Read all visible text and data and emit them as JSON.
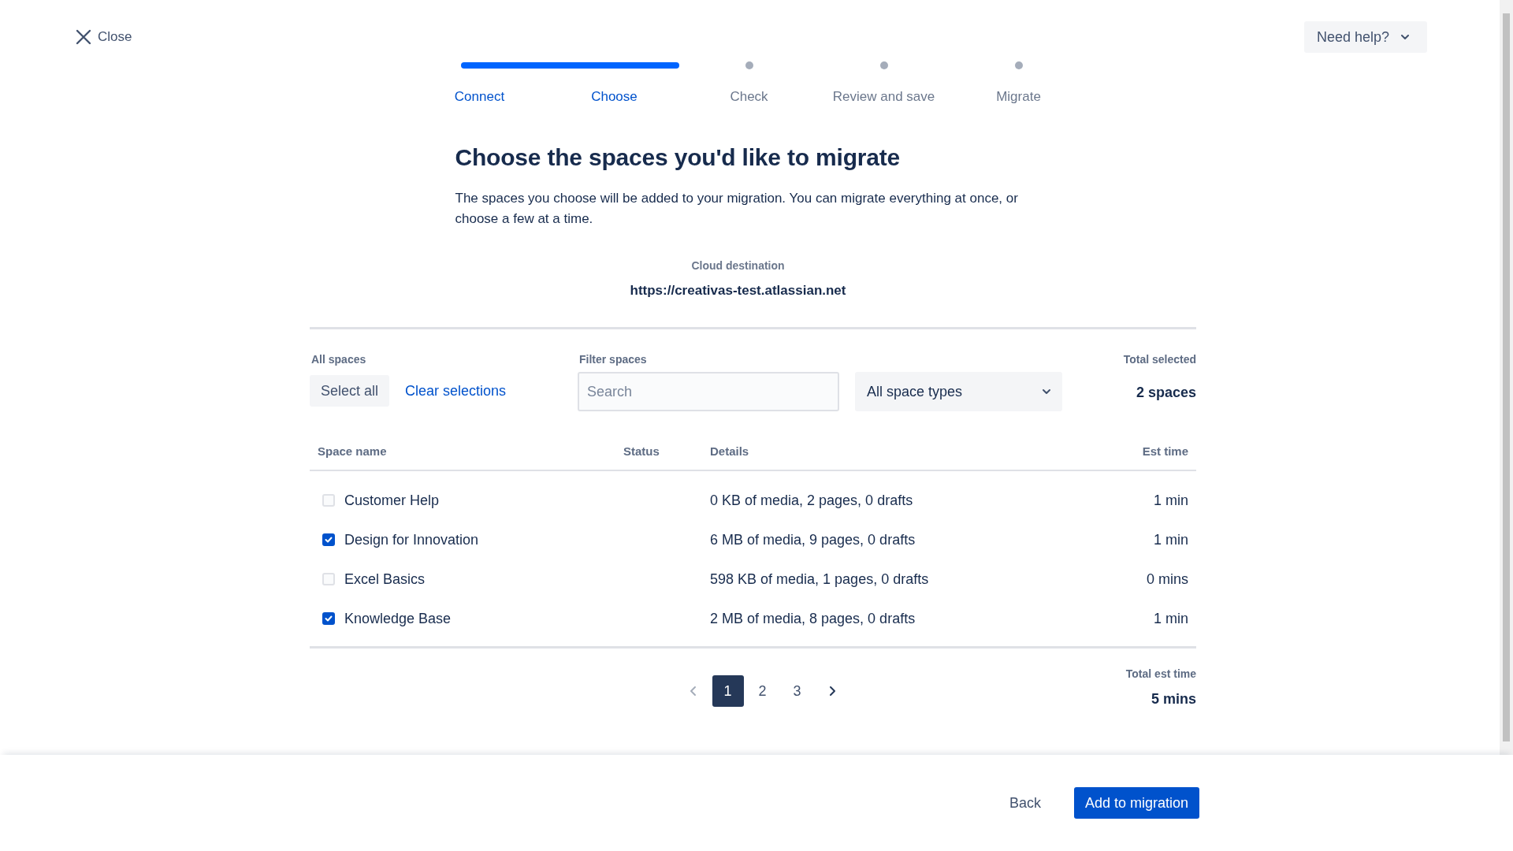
{
  "header": {
    "close_label": "Close",
    "help_button": "Need help?"
  },
  "steps": [
    {
      "label": "Connect",
      "completed": true
    },
    {
      "label": "Choose",
      "completed": true
    },
    {
      "label": "Check",
      "completed": false
    },
    {
      "label": "Review and save",
      "completed": false
    },
    {
      "label": "Migrate",
      "completed": false
    }
  ],
  "title": "Choose the spaces you'd like to migrate",
  "description": "The spaces you choose will be added to your migration. You can migrate everything at once, or choose a few at a time.",
  "destination": {
    "label": "Cloud destination",
    "url": "https://creativas-test.atlassian.net"
  },
  "filters": {
    "all_spaces_label": "All spaces",
    "select_all": "Select all",
    "clear_selections": "Clear selections",
    "filter_label": "Filter spaces",
    "search": {
      "placeholder": "Search"
    },
    "space_type": "All space types",
    "total_label": "Total selected",
    "total_value": "2 spaces"
  },
  "table": {
    "columns": [
      "Space name",
      "Status",
      "Details",
      "Est time"
    ],
    "rows": [
      {
        "name": "Customer Help",
        "checked": false,
        "details": "0 KB of media, 2 pages, 0 drafts",
        "est_time": "1 min"
      },
      {
        "name": "Design for Innovation",
        "checked": true,
        "details": "6 MB of media, 9 pages, 0 drafts",
        "est_time": "1 min"
      },
      {
        "name": "Excel Basics",
        "checked": false,
        "details": "598 KB of media, 1 pages, 0 drafts",
        "est_time": "0 mins"
      },
      {
        "name": "Knowledge Base",
        "checked": true,
        "details": "2 MB of media, 8 pages, 0 drafts",
        "est_time": "1 min"
      }
    ]
  },
  "pagination": {
    "previous_disabled": true,
    "next_disabled": false,
    "pages": [
      {
        "label": "1",
        "selected": true
      },
      {
        "label": "2",
        "selected": false
      },
      {
        "label": "3",
        "selected": false
      }
    ]
  },
  "total_time": {
    "label": "Total est time",
    "value": "5 mins"
  },
  "footer": {
    "back": "Back",
    "primary": "Add to migration"
  }
}
